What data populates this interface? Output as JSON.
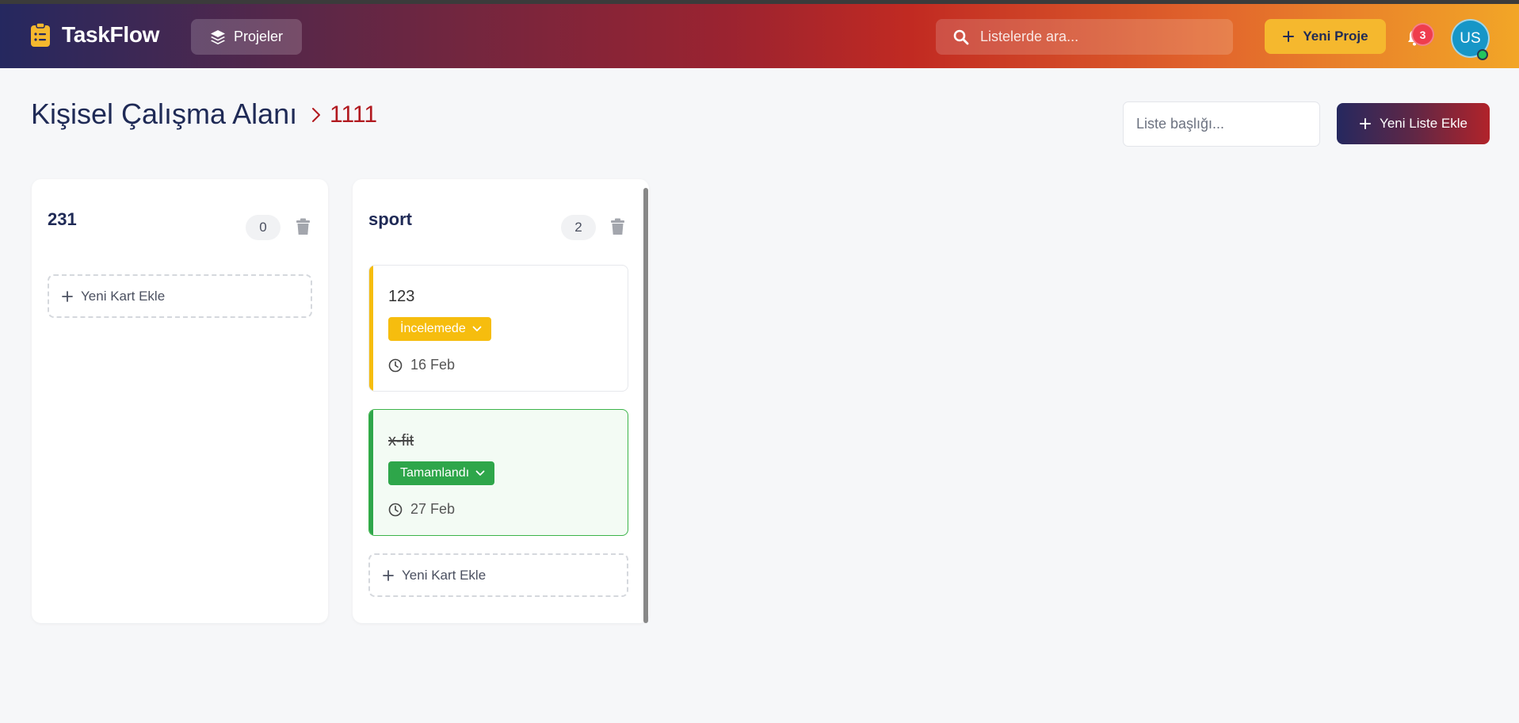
{
  "app": {
    "brand_name": "TaskFlow",
    "projects_label": "Projeler",
    "search_placeholder": "Listelerde ara...",
    "new_project_label": "Yeni Proje",
    "notifications_count": "3",
    "user_initials": "US"
  },
  "page": {
    "title": "Kişisel Çalışma Alanı",
    "breadcrumb_current": "1111",
    "list_title_placeholder": "Liste başlığı...",
    "add_list_label": "Yeni Liste Ekle"
  },
  "lists": [
    {
      "title": "231",
      "count": "0",
      "add_card_label": "Yeni Kart Ekle",
      "cards": []
    },
    {
      "title": "sport",
      "count": "2",
      "add_card_label": "Yeni Kart Ekle",
      "cards": [
        {
          "title": "123",
          "status": "İncelemede",
          "date": "16 Feb",
          "color": "#f6bd0e"
        },
        {
          "title": "x-fit",
          "status": "Tamamlandı",
          "date": "27 Feb",
          "color": "#2ea64a"
        }
      ]
    }
  ],
  "colors": {
    "brand_navy": "#1f2a56",
    "accent_red": "#b1191f",
    "accent_yellow": "#f5b82e",
    "status_review": "#f6bd0e",
    "status_done": "#2ea64a"
  },
  "icons": [
    "clipboard-icon",
    "layers-icon",
    "search-icon",
    "plus-icon",
    "bell-icon",
    "chevron-right-icon",
    "trash-icon",
    "chevron-down-icon",
    "clock-icon"
  ]
}
